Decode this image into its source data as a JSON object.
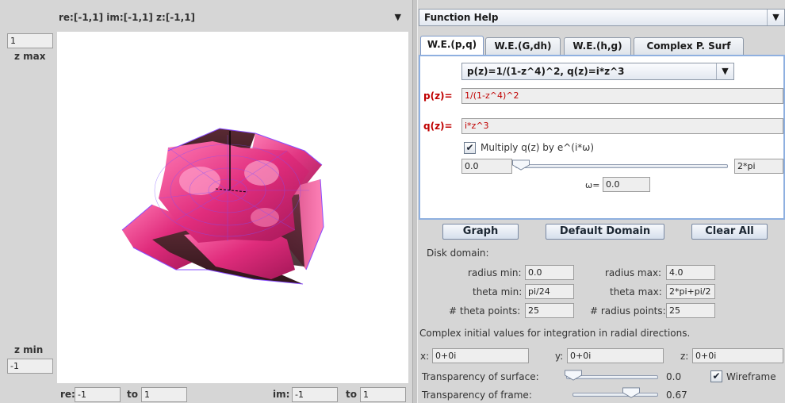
{
  "graph_panel": {
    "domain_label": "re:[-1,1] im:[-1,1] z:[-1,1]",
    "zmax_value": "1",
    "zmax_label": "z max",
    "zmin_label": "z min",
    "zmin_value": "-1",
    "re_label": "re:",
    "re_from": "-1",
    "re_to_label": "to",
    "re_to": "1",
    "im_label": "im:",
    "im_from": "-1",
    "im_to_label": "to",
    "im_to": "1"
  },
  "help_panel": {
    "title": "Function Help"
  },
  "tabs": [
    {
      "label": "W.E.(p,q)",
      "active": true
    },
    {
      "label": "W.E.(G,dh)",
      "active": false
    },
    {
      "label": "W.E.(h,g)",
      "active": false
    },
    {
      "label": "Complex P. Surf",
      "active": false
    }
  ],
  "weierstrass": {
    "preset": "p(z)=1/(1-z^4)^2, q(z)=i*z^3",
    "p_label": "p(z)=",
    "p_value": "1/(1-z^4)^2",
    "q_label": "q(z)=",
    "q_value": "i*z^3",
    "multiply_label": "Multiply q(z) by e^(i*ω)",
    "multiply_checked": true,
    "omega_min": "0.0",
    "omega_max": "2*pi",
    "omega_label": "ω=",
    "omega_value": "0.0"
  },
  "buttons": {
    "graph": "Graph",
    "default_domain": "Default Domain",
    "clear_all": "Clear All"
  },
  "domain": {
    "heading": "Disk domain:",
    "radius_min_label": "radius min:",
    "radius_min": "0.0",
    "radius_max_label": "radius max:",
    "radius_max": "4.0",
    "theta_min_label": "theta min:",
    "theta_min": "pi/24",
    "theta_max_label": "theta max:",
    "theta_max": "2*pi+pi/2",
    "theta_points_label": "# theta points:",
    "theta_points": "25",
    "radius_points_label": "# radius points:",
    "radius_points": "25"
  },
  "initial_values": {
    "heading": "Complex initial values for integration in radial directions.",
    "x_label": "x:",
    "x_value": "0+0i",
    "y_label": "y:",
    "y_value": "0+0i",
    "z_label": "z:",
    "z_value": "0+0i"
  },
  "appearance": {
    "surface_transparency_label": "Transparency of surface:",
    "surface_transparency": "0.0",
    "surface_transparency_level": 0.0,
    "wireframe_label": "Wireframe",
    "wireframe_checked": true,
    "frame_transparency_label": "Transparency of frame:",
    "frame_transparency": "0.67",
    "frame_transparency_level": 0.67
  },
  "colors": {
    "surface_light": "#ff6aa8",
    "surface_mid": "#c2185b",
    "surface_dark": "#3a1a22",
    "wire": "#8a4dff",
    "label_red": "#c00000"
  }
}
